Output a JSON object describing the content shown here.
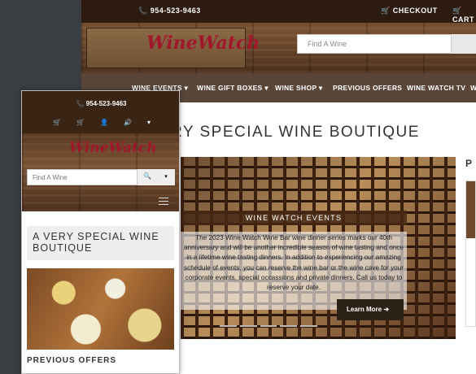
{
  "desktop": {
    "phone": "954-523-9463",
    "checkout": "CHECKOUT",
    "cart": "CART",
    "logo": "WineWatch",
    "search": {
      "placeholder": "Find A Wine"
    },
    "nav": [
      "WINE EVENTS ▾",
      "WINE GIFT BOXES ▾",
      "WINE SHOP ▾",
      "PREVIOUS OFFERS",
      "WINE WATCH TV",
      "W"
    ],
    "title": "RY SPECIAL WINE BOUTIQUE",
    "hero": {
      "label": "WINE WATCH EVENTS",
      "text": "The 2023 Wine Watch Wine Bar wine dinner series marks our 40th anniversary and will be another incredible season of wine tasting and once in a lifetime wine tasting dinners. In addition to experiencing our amazing schedule of events, you can reserve the wine bar or the wine cave for your corporate events, special occassions and private dinners. Call us today to reserve your date.",
      "button": "Learn More ➜"
    },
    "side_head": "P"
  },
  "mobile": {
    "phone": "954-523-9463",
    "logo": "WineWatch",
    "search": {
      "placeholder": "Find A Wine"
    },
    "title": "A VERY SPECIAL WINE BOUTIQUE",
    "section": "PREVIOUS OFFERS"
  }
}
